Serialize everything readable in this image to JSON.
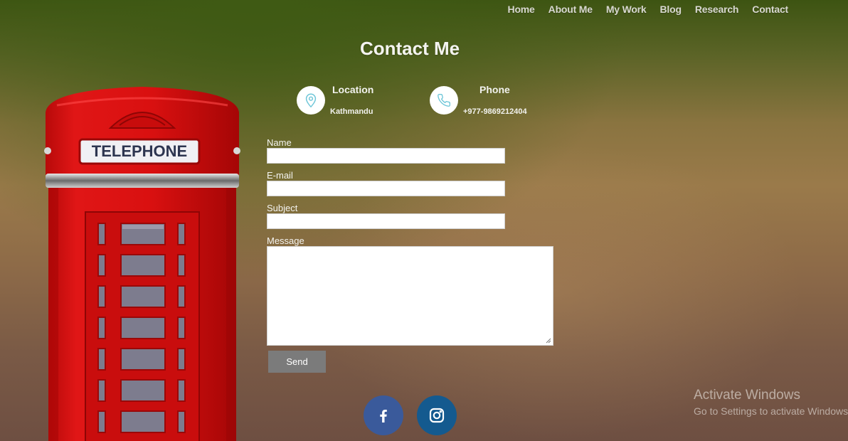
{
  "nav": {
    "items": [
      {
        "label": "Home"
      },
      {
        "label": "About Me"
      },
      {
        "label": "My Work"
      },
      {
        "label": "Blog"
      },
      {
        "label": "Research"
      },
      {
        "label": "Contact"
      }
    ]
  },
  "hero": {
    "booth_sign": "TELEPHONE"
  },
  "page": {
    "title": "Contact Me"
  },
  "info": {
    "location": {
      "heading": "Location",
      "value": "Kathmandu",
      "icon": "map-pin-icon"
    },
    "phone": {
      "heading": "Phone",
      "value": "+977-9869212404",
      "icon": "phone-icon"
    },
    "icon_color": "#6ec6d8"
  },
  "form": {
    "name_label": "Name",
    "email_label": "E-mail",
    "subject_label": "Subject",
    "message_label": "Message",
    "name_value": "",
    "email_value": "",
    "subject_value": "",
    "message_value": "",
    "send_label": "Send"
  },
  "social": {
    "facebook": {
      "icon": "facebook-icon",
      "color": "#3a5a9b"
    },
    "instagram": {
      "icon": "instagram-icon",
      "color": "#145a8f"
    }
  },
  "watermark": {
    "title": "Activate Windows",
    "subtitle": "Go to Settings to activate Windows."
  }
}
